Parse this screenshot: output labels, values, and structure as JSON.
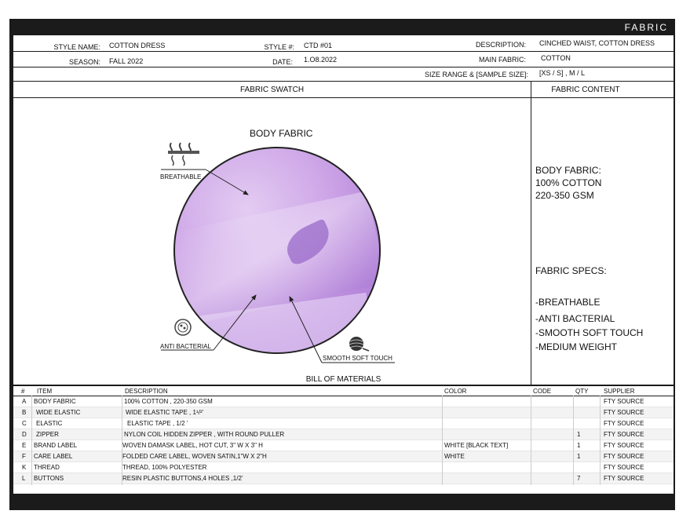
{
  "header": {
    "section_title": "FABRIC",
    "style_name_label": "STYLE NAME:",
    "style_name": "COTTON DRESS",
    "style_no_label": "STYLE #:",
    "style_no": "CTD #01",
    "description_label": "DESCRIPTION:",
    "description": "CINCHED WAIST, COTTON DRESS",
    "season_label": "SEASON:",
    "season": "FALL 2022",
    "date_label": "DATE:",
    "date": "1.O8.2022",
    "main_fabric_label": "MAIN FABRIC:",
    "main_fabric": "COTTON",
    "size_range_label": "SIZE RANGE & [SAMPLE SIZE]:",
    "size_range": "[XS / S] , M / L"
  },
  "swatch": {
    "section_title": "FABRIC SWATCH",
    "body_fabric_title": "BODY FABRIC",
    "callout_breathable": "BREATHABLE",
    "callout_anti_bacterial": "ANTI BACTERIAL",
    "callout_smooth": "SMOOTH SOFT TOUCH",
    "fabric_color": "#c9a2e6"
  },
  "content": {
    "section_title": "FABRIC CONTENT",
    "body_fabric_label": "BODY FABRIC:",
    "body_fabric_composition": "100%  COTTON",
    "body_fabric_weight": "220-350 GSM",
    "specs_label": "FABRIC SPECS:",
    "specs": [
      "-BREATHABLE",
      "-ANTI BACTERIAL",
      "-SMOOTH SOFT TOUCH",
      "-MEDIUM WEIGHT"
    ]
  },
  "bom": {
    "title": "BILL OF MATERIALS",
    "columns": {
      "no": "#",
      "item": "ITEM",
      "description": "DESCRIPTION",
      "color": "COLOR",
      "code": "CODE",
      "qty": "QTY",
      "supplier": "SUPPLIER"
    },
    "rows": [
      {
        "no": "A",
        "item": "BODY FABRIC",
        "description": "100%  COTTON , 220-350 GSM",
        "color": "",
        "code": "",
        "qty": "",
        "supplier": "FTY SOURCE"
      },
      {
        "no": "B",
        "item": "WIDE ELASTIC",
        "description": "WIDE ELASTIC TAPE , 1¹/²’",
        "color": "",
        "code": "",
        "qty": "",
        "supplier": "FTY SOURCE"
      },
      {
        "no": "C",
        "item": "ELASTIC",
        "description": "ELASTIC TAPE , 1/2    ’",
        "color": "",
        "code": "",
        "qty": "",
        "supplier": "FTY SOURCE"
      },
      {
        "no": "D",
        "item": "ZIPPER",
        "description": "NYLON COIL HIDDEN ZIPPER , WITH ROUND PULLER",
        "color": "",
        "code": "",
        "qty": "1",
        "supplier": "FTY SOURCE"
      },
      {
        "no": "E",
        "item": "BRAND LABEL",
        "description": "WOVEN DAMASK LABEL, HOT CUT, 3\" W  X  3\" H",
        "color": "WHITE [BLACK TEXT]",
        "code": "",
        "qty": "1",
        "supplier": "FTY SOURCE"
      },
      {
        "no": "F",
        "item": "CARE LABEL",
        "description": "FOLDED CARE LABEL, WOVEN SATIN,1\"W X 2\"H",
        "color": "WHITE",
        "code": "",
        "qty": "1",
        "supplier": "FTY SOURCE"
      },
      {
        "no": "K",
        "item": "THREAD",
        "description": "THREAD, 100% POLYESTER",
        "color": "",
        "code": "",
        "qty": "",
        "supplier": "FTY SOURCE"
      },
      {
        "no": "L",
        "item": "BUTTONS",
        "description": "RESIN PLASTIC BUTTONS,4 HOLES ,1/2’",
        "color": "",
        "code": "",
        "qty": "7",
        "supplier": "FTY SOURCE"
      }
    ]
  }
}
